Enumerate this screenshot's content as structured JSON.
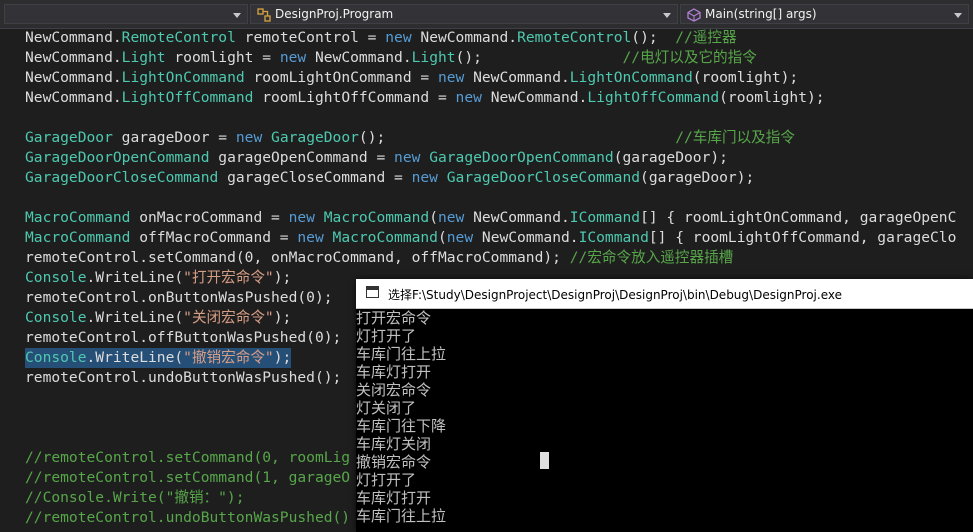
{
  "navbar": {
    "member_dropdown": "",
    "type_dropdown": "DesignProj.Program",
    "method_dropdown": "Main(string[] args)"
  },
  "code": {
    "l1": {
      "a": "NewCommand.",
      "b": "RemoteControl",
      "c": " remoteControl = ",
      "d": "new",
      "e": " NewCommand.",
      "f": "RemoteControl",
      "g": "();  ",
      "h": "//遥控器"
    },
    "l2": {
      "a": "NewCommand.",
      "b": "Light",
      "c": " roomlight = ",
      "d": "new",
      "e": " NewCommand.",
      "f": "Light",
      "g": "();                ",
      "h": "//电灯以及它的指令"
    },
    "l3": {
      "a": "NewCommand.",
      "b": "LightOnCommand",
      "c": " roomLightOnCommand = ",
      "d": "new",
      "e": " NewCommand.",
      "f": "LightOnCommand",
      "g": "(roomlight);"
    },
    "l4": {
      "a": "NewCommand.",
      "b": "LightOffCommand",
      "c": " roomLightOffCommand = ",
      "d": "new",
      "e": " NewCommand.",
      "f": "LightOffCommand",
      "g": "(roomlight);"
    },
    "l6": {
      "a": "GarageDoor",
      "b": " garageDoor = ",
      "c": "new",
      "d": " ",
      "e": "GarageDoor",
      "f": "();                                 ",
      "g": "//车库门以及指令"
    },
    "l7": {
      "a": "GarageDoorOpenCommand",
      "b": " garageOpenCommand = ",
      "c": "new",
      "d": " ",
      "e": "GarageDoorOpenCommand",
      "f": "(garageDoor);"
    },
    "l8": {
      "a": "GarageDoorCloseCommand",
      "b": " garageCloseCommand = ",
      "c": "new",
      "d": " ",
      "e": "GarageDoorCloseCommand",
      "f": "(garageDoor);"
    },
    "l10": {
      "a": "MacroCommand",
      "b": " onMacroCommand = ",
      "c": "new",
      "d": " ",
      "e": "MacroCommand",
      "f": "(",
      "g": "new",
      "h": " NewCommand.",
      "i": "ICommand",
      "j": "[] { roomLightOnCommand, garageOpenC"
    },
    "l11": {
      "a": "MacroCommand",
      "b": " offMacroCommand = ",
      "c": "new",
      "d": " ",
      "e": "MacroCommand",
      "f": "(",
      "g": "new",
      "h": " NewCommand.",
      "i": "ICommand",
      "j": "[] { roomLightOffCommand, garageClo"
    },
    "l12": {
      "a": "remoteControl.setCommand(0, onMacroCommand, offMacroCommand); ",
      "b": "//宏命令放入遥控器插槽"
    },
    "l13": {
      "a": "Console",
      "b": ".WriteLine(",
      "c": "\"打开宏命令\"",
      "d": ");"
    },
    "l14": {
      "a": "remoteControl.onButtonWasPushed(0);"
    },
    "l15": {
      "a": "Console",
      "b": ".WriteLine(",
      "c": "\"关闭宏命令\"",
      "d": ");"
    },
    "l16": {
      "a": "remoteControl.offButtonWasPushed(0);"
    },
    "l17": {
      "a": "Console",
      "b": ".WriteLine(",
      "c": "\"撤销宏命令\"",
      "d": ");"
    },
    "l18": {
      "a": "remoteControl.undoButtonWasPushed();"
    },
    "l22": {
      "a": "//remoteControl.setCommand(0, roomLig"
    },
    "l23": {
      "a": "//remoteControl.setCommand(1, garageO"
    },
    "l24": {
      "a": "//Console.Write(\"撤销：\");"
    },
    "l25": {
      "a": "//remoteControl.undoButtonWasPushed()"
    }
  },
  "console": {
    "title": "选择F:\\Study\\DesignProject\\DesignProj\\DesignProj\\bin\\Debug\\DesignProj.exe",
    "lines": [
      "打开宏命令",
      "灯打开了",
      "车库门往上拉",
      "车库灯打开",
      "关闭宏命令",
      "灯关闭了",
      "车库门往下降",
      "车库灯关闭",
      "撤销宏命令",
      "灯打开了",
      "车库灯打开",
      "车库门往上拉"
    ]
  },
  "colors": {
    "keyword": "#569cd6",
    "type": "#4ec9b0",
    "string": "#d69d85",
    "comment": "#57a64a",
    "editor_bg": "#1e1e1e"
  }
}
